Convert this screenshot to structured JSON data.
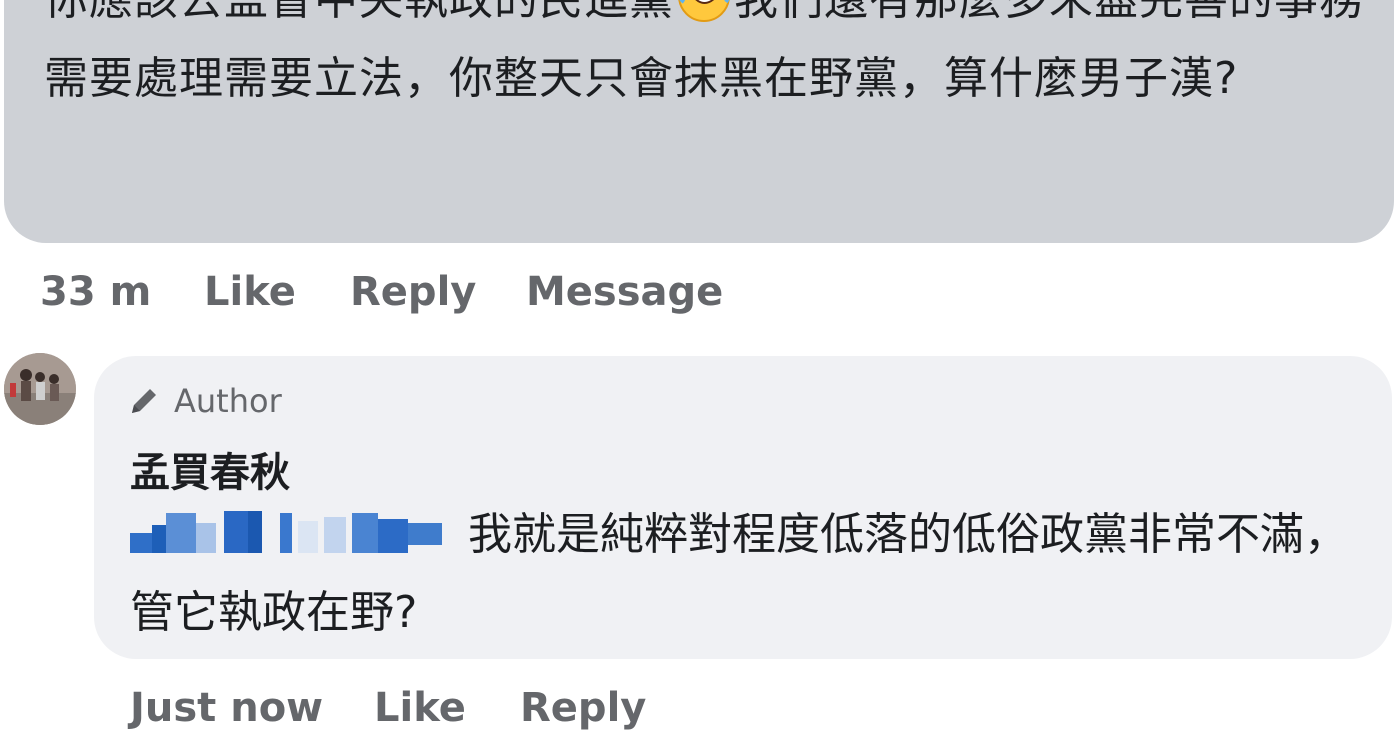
{
  "top_comment": {
    "text_before_emoji": "你應該去監督中央執政的民進黨",
    "emoji": "rolling-on-floor-laughing-emoji",
    "text_after_emoji": "我們還有那麼多未盡完善的事務需要處理需要立法，你整天只會抹黑在野黨，算什麼男子漢?",
    "time": "33 m",
    "like_label": "Like",
    "reply_label": "Reply",
    "message_label": "Message"
  },
  "reply_comment": {
    "badge_icon": "pencil-icon",
    "badge_label": "Author",
    "author_name": "孟買春秋",
    "mention": "redacted-name",
    "text": "我就是純粹對程度低落的低俗政黨非常不滿，管它執政在野?",
    "time": "Just now",
    "like_label": "Like",
    "reply_label": "Reply"
  },
  "colors": {
    "top_bubble": "#ced1d6",
    "reply_bubble": "#f0f1f4",
    "secondary_text": "#65676b",
    "primary_text": "#1c1e21",
    "redaction_blue": "#2f6fc8"
  }
}
